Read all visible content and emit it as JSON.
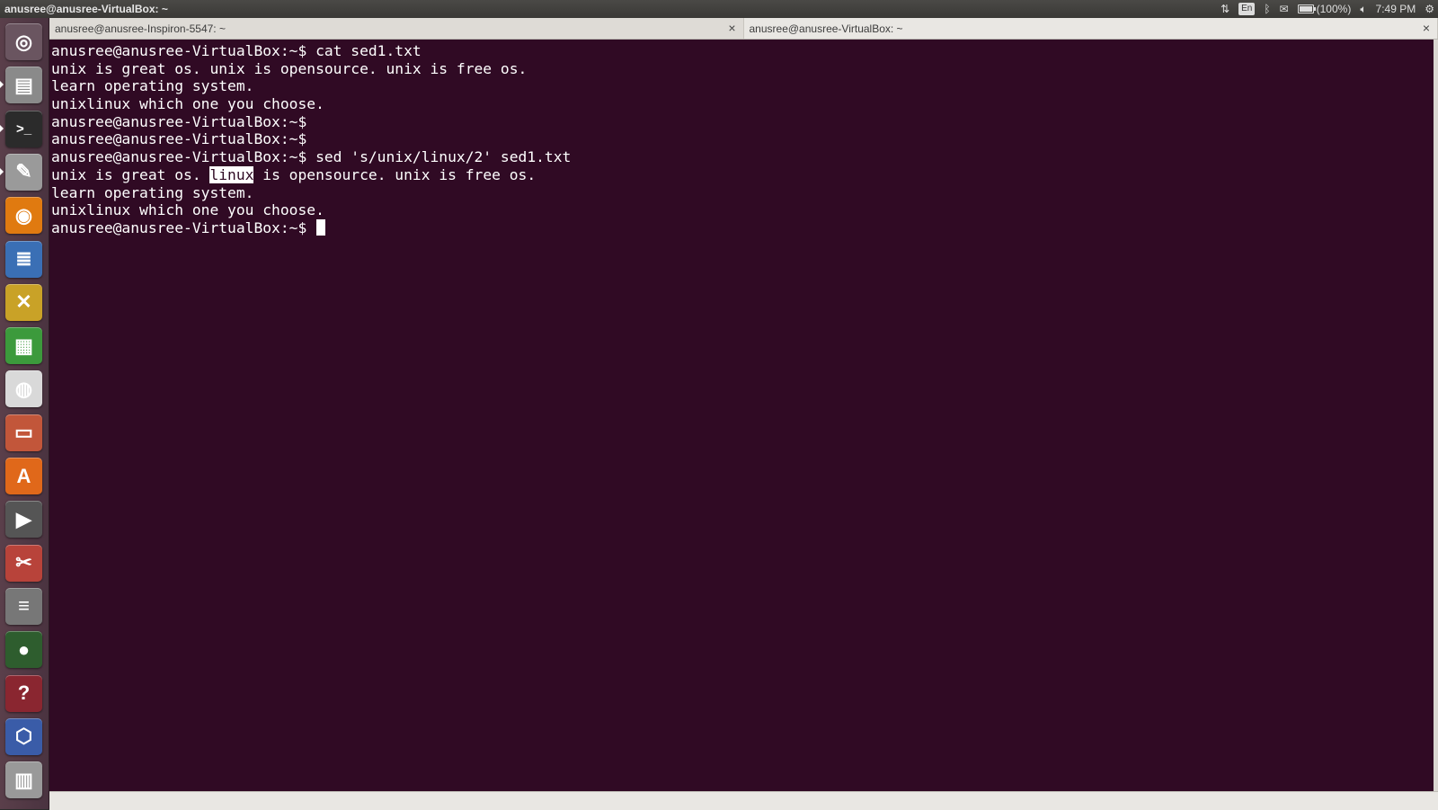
{
  "topbar": {
    "title": "anusree@anusree-VirtualBox: ~",
    "indicators": {
      "network_icon": "network-updown-icon",
      "keyboard": "En",
      "bluetooth_icon": "bluetooth-icon",
      "mail_icon": "mail-icon",
      "battery": "(100%)",
      "volume_icon": "volume-icon",
      "clock": "7:49 PM",
      "settings_icon": "gear-icon"
    }
  },
  "launcher": {
    "items": [
      {
        "name": "dash-home",
        "icon": "ubuntu-logo-icon",
        "glyph": "◎"
      },
      {
        "name": "files",
        "icon": "file-manager-icon",
        "glyph": "▤"
      },
      {
        "name": "terminal",
        "icon": "terminal-icon",
        "glyph": ">_"
      },
      {
        "name": "text-editor",
        "icon": "text-editor-icon",
        "glyph": "✎"
      },
      {
        "name": "firefox",
        "icon": "firefox-icon",
        "glyph": "◉"
      },
      {
        "name": "writer",
        "icon": "writer-document-icon",
        "glyph": "≣"
      },
      {
        "name": "xchat",
        "icon": "xchat-icon",
        "glyph": "✕"
      },
      {
        "name": "calc",
        "icon": "spreadsheet-icon",
        "glyph": "▦"
      },
      {
        "name": "chrome",
        "icon": "chrome-icon",
        "glyph": "◍"
      },
      {
        "name": "impress",
        "icon": "presentation-icon",
        "glyph": "▭"
      },
      {
        "name": "software-center",
        "icon": "software-center-icon",
        "glyph": "A"
      },
      {
        "name": "video-editor",
        "icon": "video-clapper-icon",
        "glyph": "▶"
      },
      {
        "name": "system-settings",
        "icon": "settings-tools-icon",
        "glyph": "✂"
      },
      {
        "name": "stacks",
        "icon": "stack-icon",
        "glyph": "≡"
      },
      {
        "name": "globe",
        "icon": "globe-icon",
        "glyph": "●"
      },
      {
        "name": "help",
        "icon": "help-icon",
        "glyph": "?"
      },
      {
        "name": "virtualbox",
        "icon": "virtualbox-icon",
        "glyph": "⬡"
      },
      {
        "name": "trash",
        "icon": "trash-icon",
        "glyph": "▥"
      }
    ]
  },
  "tabs": [
    {
      "label": "anusree@anusree-Inspiron-5547: ~",
      "close": "×"
    },
    {
      "label": "anusree@anusree-VirtualBox: ~",
      "close": "×"
    }
  ],
  "terminal": {
    "lines": [
      {
        "text": "anusree@anusree-VirtualBox:~$ cat sed1.txt"
      },
      {
        "text": "unix is great os. unix is opensource. unix is free os."
      },
      {
        "text": "learn operating system."
      },
      {
        "text": "unixlinux which one you choose."
      },
      {
        "text": "anusree@anusree-VirtualBox:~$ "
      },
      {
        "text": "anusree@anusree-VirtualBox:~$ "
      },
      {
        "text": "anusree@anusree-VirtualBox:~$ sed 's/unix/linux/2' sed1.txt"
      },
      {
        "before": "unix is great os. ",
        "highlight": "linux",
        "after": " is opensource. unix is free os."
      },
      {
        "text": "learn operating system."
      },
      {
        "text": "unixlinux which one you choose."
      },
      {
        "text": "anusree@anusree-VirtualBox:~$ ",
        "cursor": true
      }
    ]
  },
  "colors": {
    "terminal_bg": "#300a24",
    "terminal_fg": "#ffffff",
    "launcher_bg": "#5a3f4a"
  }
}
